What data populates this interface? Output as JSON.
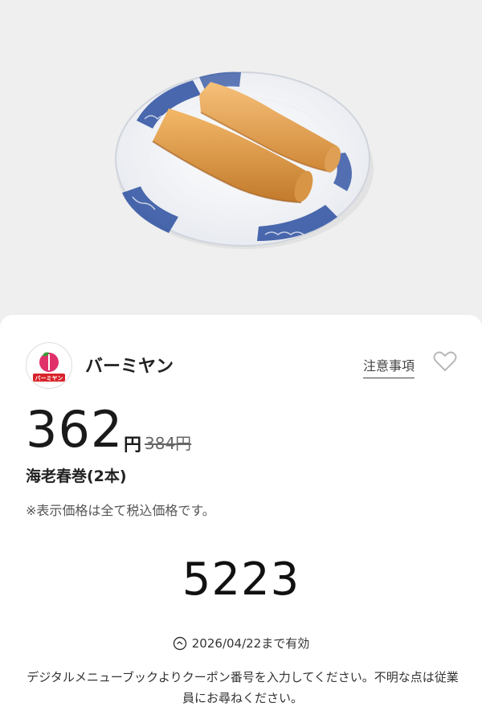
{
  "hero": {
    "image_desc": "spring-roll-plate-photo"
  },
  "brand": {
    "logo_text": "バーミヤン",
    "name": "バーミヤン"
  },
  "actions": {
    "notice_label": "注意事項",
    "favorite_icon": "heart-outline-icon"
  },
  "price": {
    "current": "362",
    "unit": "円",
    "original": "384円"
  },
  "item": {
    "name": "海老春巻(2本)",
    "tax_note": "※表示価格は全て税込価格です。"
  },
  "coupon": {
    "code": "5223",
    "validity": "2026/04/22まで有効",
    "validity_icon": "clock-icon",
    "instructions": "デジタルメニューブックよりクーポン番号を入力してください。不明な点は従業員にお尋ねください。"
  },
  "colors": {
    "hero_bg": "#efefef",
    "plate_blue": "#2c4fa0",
    "logo_pink": "#e0306a",
    "logo_red": "#d8232a"
  }
}
